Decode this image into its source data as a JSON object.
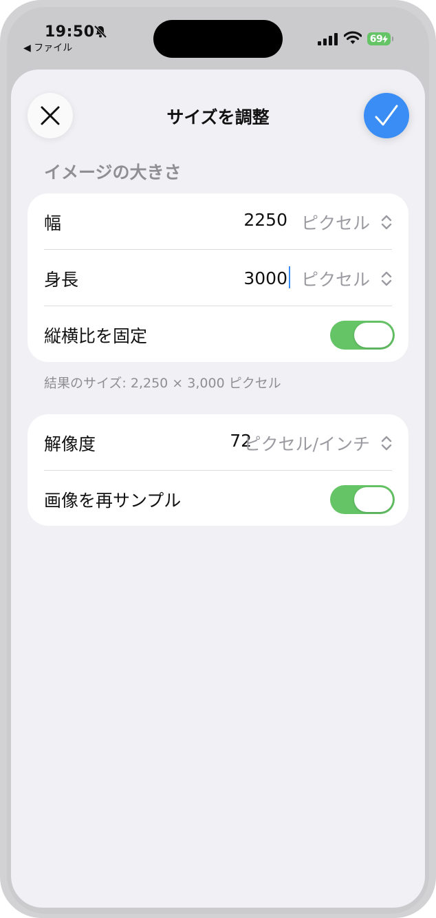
{
  "status_bar": {
    "time": "19:50",
    "back_label": "◀ ファイル",
    "battery": "69"
  },
  "nav": {
    "title": "サイズを調整",
    "close_icon": "close-icon",
    "done_icon": "checkmark-icon",
    "accent_color": "#3a8df5"
  },
  "image_size": {
    "header": "イメージの大きさ",
    "width": {
      "label": "幅",
      "value": "2250",
      "unit": "ピクセル"
    },
    "height": {
      "label": "身長",
      "value": "3000",
      "unit": "ピクセル"
    },
    "lock_ratio": {
      "label": "縦横比を固定",
      "on": true
    },
    "result_text": "結果のサイズ: 2,250 × 3,000 ピクセル"
  },
  "resolution": {
    "label": "解像度",
    "value": "72",
    "unit": "ピクセル/インチ",
    "resample": {
      "label": "画像を再サンプル",
      "on": true
    }
  },
  "colors": {
    "toggle_on": "#65c466",
    "background": "#f0f0f5"
  }
}
